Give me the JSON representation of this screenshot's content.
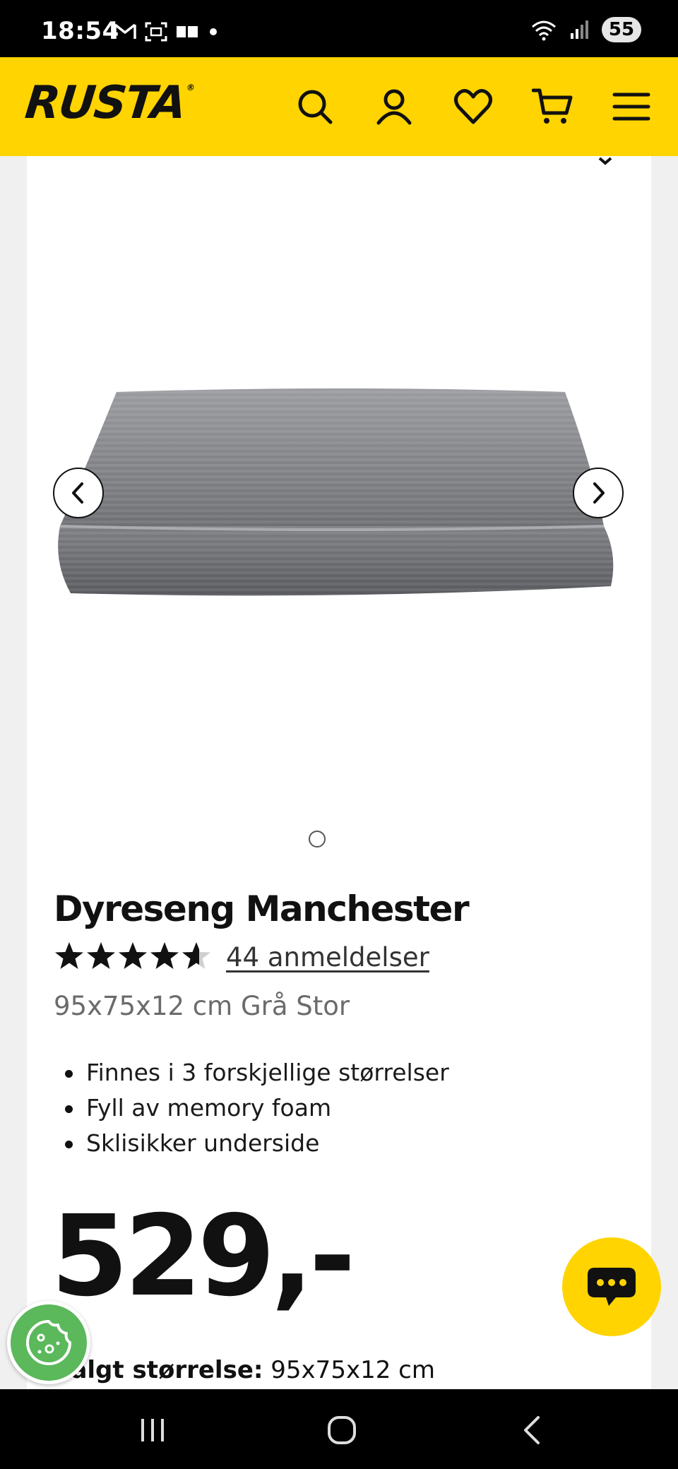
{
  "status_bar": {
    "time": "18:54",
    "battery": "55",
    "icons_left": [
      "gmail-icon",
      "screenshot-icon",
      "message-icon",
      "dot-icon"
    ],
    "icons_right": [
      "wifi-icon",
      "signal-icon"
    ]
  },
  "header": {
    "logo": "RUSTA",
    "logo_mark": "®",
    "icons": [
      "search-icon",
      "account-icon",
      "heart-icon",
      "cart-icon",
      "menu-icon"
    ],
    "accent_color": "#ffd400"
  },
  "carousel": {
    "prev_icon": "chevron-left-icon",
    "next_icon": "chevron-right-icon",
    "slide_count": 1,
    "active_slide": 1
  },
  "product": {
    "title": "Dyreseng Manchester",
    "rating": 4.6,
    "rating_max": 5,
    "reviews": "44 anmeldelser",
    "variant": "95x75x12 cm Grå Stor",
    "features": [
      "Finnes i 3 forskjellige størrelser",
      "Fyll av memory foam",
      "Sklisikker underside"
    ],
    "price": "529,-",
    "selected_size_label": "Valgt størrelse:",
    "selected_size_value": "95x75x12 cm"
  },
  "floating": {
    "chat_icon": "chat-bubble-icon",
    "cookie_icon": "cookie-icon"
  },
  "nav_bar": {
    "icons": [
      "recent-apps-icon",
      "home-icon",
      "back-icon"
    ]
  }
}
